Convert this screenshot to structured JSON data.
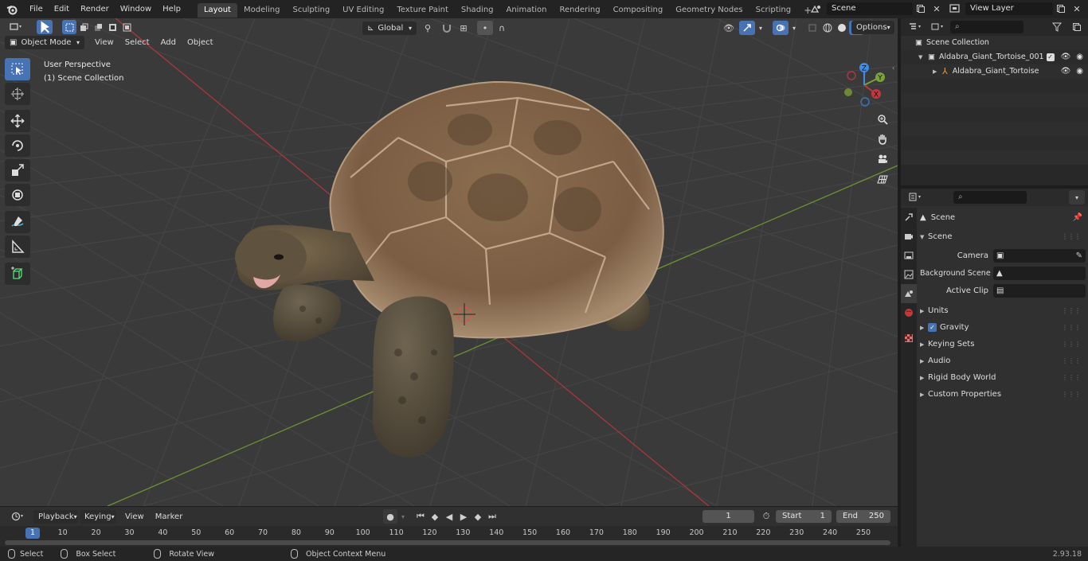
{
  "topbar": {
    "menus": [
      "File",
      "Edit",
      "Render",
      "Window",
      "Help"
    ],
    "workspaces": [
      "Layout",
      "Modeling",
      "Sculpting",
      "UV Editing",
      "Texture Paint",
      "Shading",
      "Animation",
      "Rendering",
      "Compositing",
      "Geometry Nodes",
      "Scripting"
    ],
    "active_workspace": "Layout",
    "add_tab": "+",
    "scene_name": "Scene",
    "view_layer": "View Layer"
  },
  "viewport": {
    "mode": "Object Mode",
    "menus": [
      "View",
      "Select",
      "Add",
      "Object"
    ],
    "transform_orientation": "Global",
    "options_label": "Options",
    "overlay_line1": "User Perspective",
    "overlay_line2": "(1) Scene Collection",
    "gizmo_axes": {
      "x": "X",
      "y": "Y",
      "z": "Z"
    }
  },
  "timeline": {
    "menus": [
      "Playback",
      "Keying",
      "View",
      "Marker"
    ],
    "current_frame": "1",
    "start_label": "Start",
    "start_value": "1",
    "end_label": "End",
    "end_value": "250",
    "ruler": [
      "1",
      "10",
      "20",
      "30",
      "40",
      "50",
      "60",
      "70",
      "80",
      "90",
      "100",
      "110",
      "120",
      "130",
      "140",
      "150",
      "160",
      "170",
      "180",
      "190",
      "200",
      "210",
      "220",
      "230",
      "240",
      "250"
    ]
  },
  "statusbar": {
    "select": "Select",
    "box_select": "Box Select",
    "rotate_view": "Rotate View",
    "context_menu": "Object Context Menu",
    "version": "2.93.18"
  },
  "outliner": {
    "root": "Scene Collection",
    "collection": "Aldabra_Giant_Tortoise_001",
    "object": "Aldabra_Giant_Tortoise"
  },
  "properties": {
    "context": "Scene",
    "section": "Scene",
    "camera_label": "Camera",
    "background_label": "Background Scene",
    "clip_label": "Active Clip",
    "panels": [
      "Units",
      "Gravity",
      "Keying Sets",
      "Audio",
      "Rigid Body World",
      "Custom Properties"
    ]
  },
  "colors": {
    "accent": "#4772b3",
    "x_axis": "#c3383e",
    "y_axis": "#7aa33a",
    "z_axis": "#3d8ee8"
  }
}
